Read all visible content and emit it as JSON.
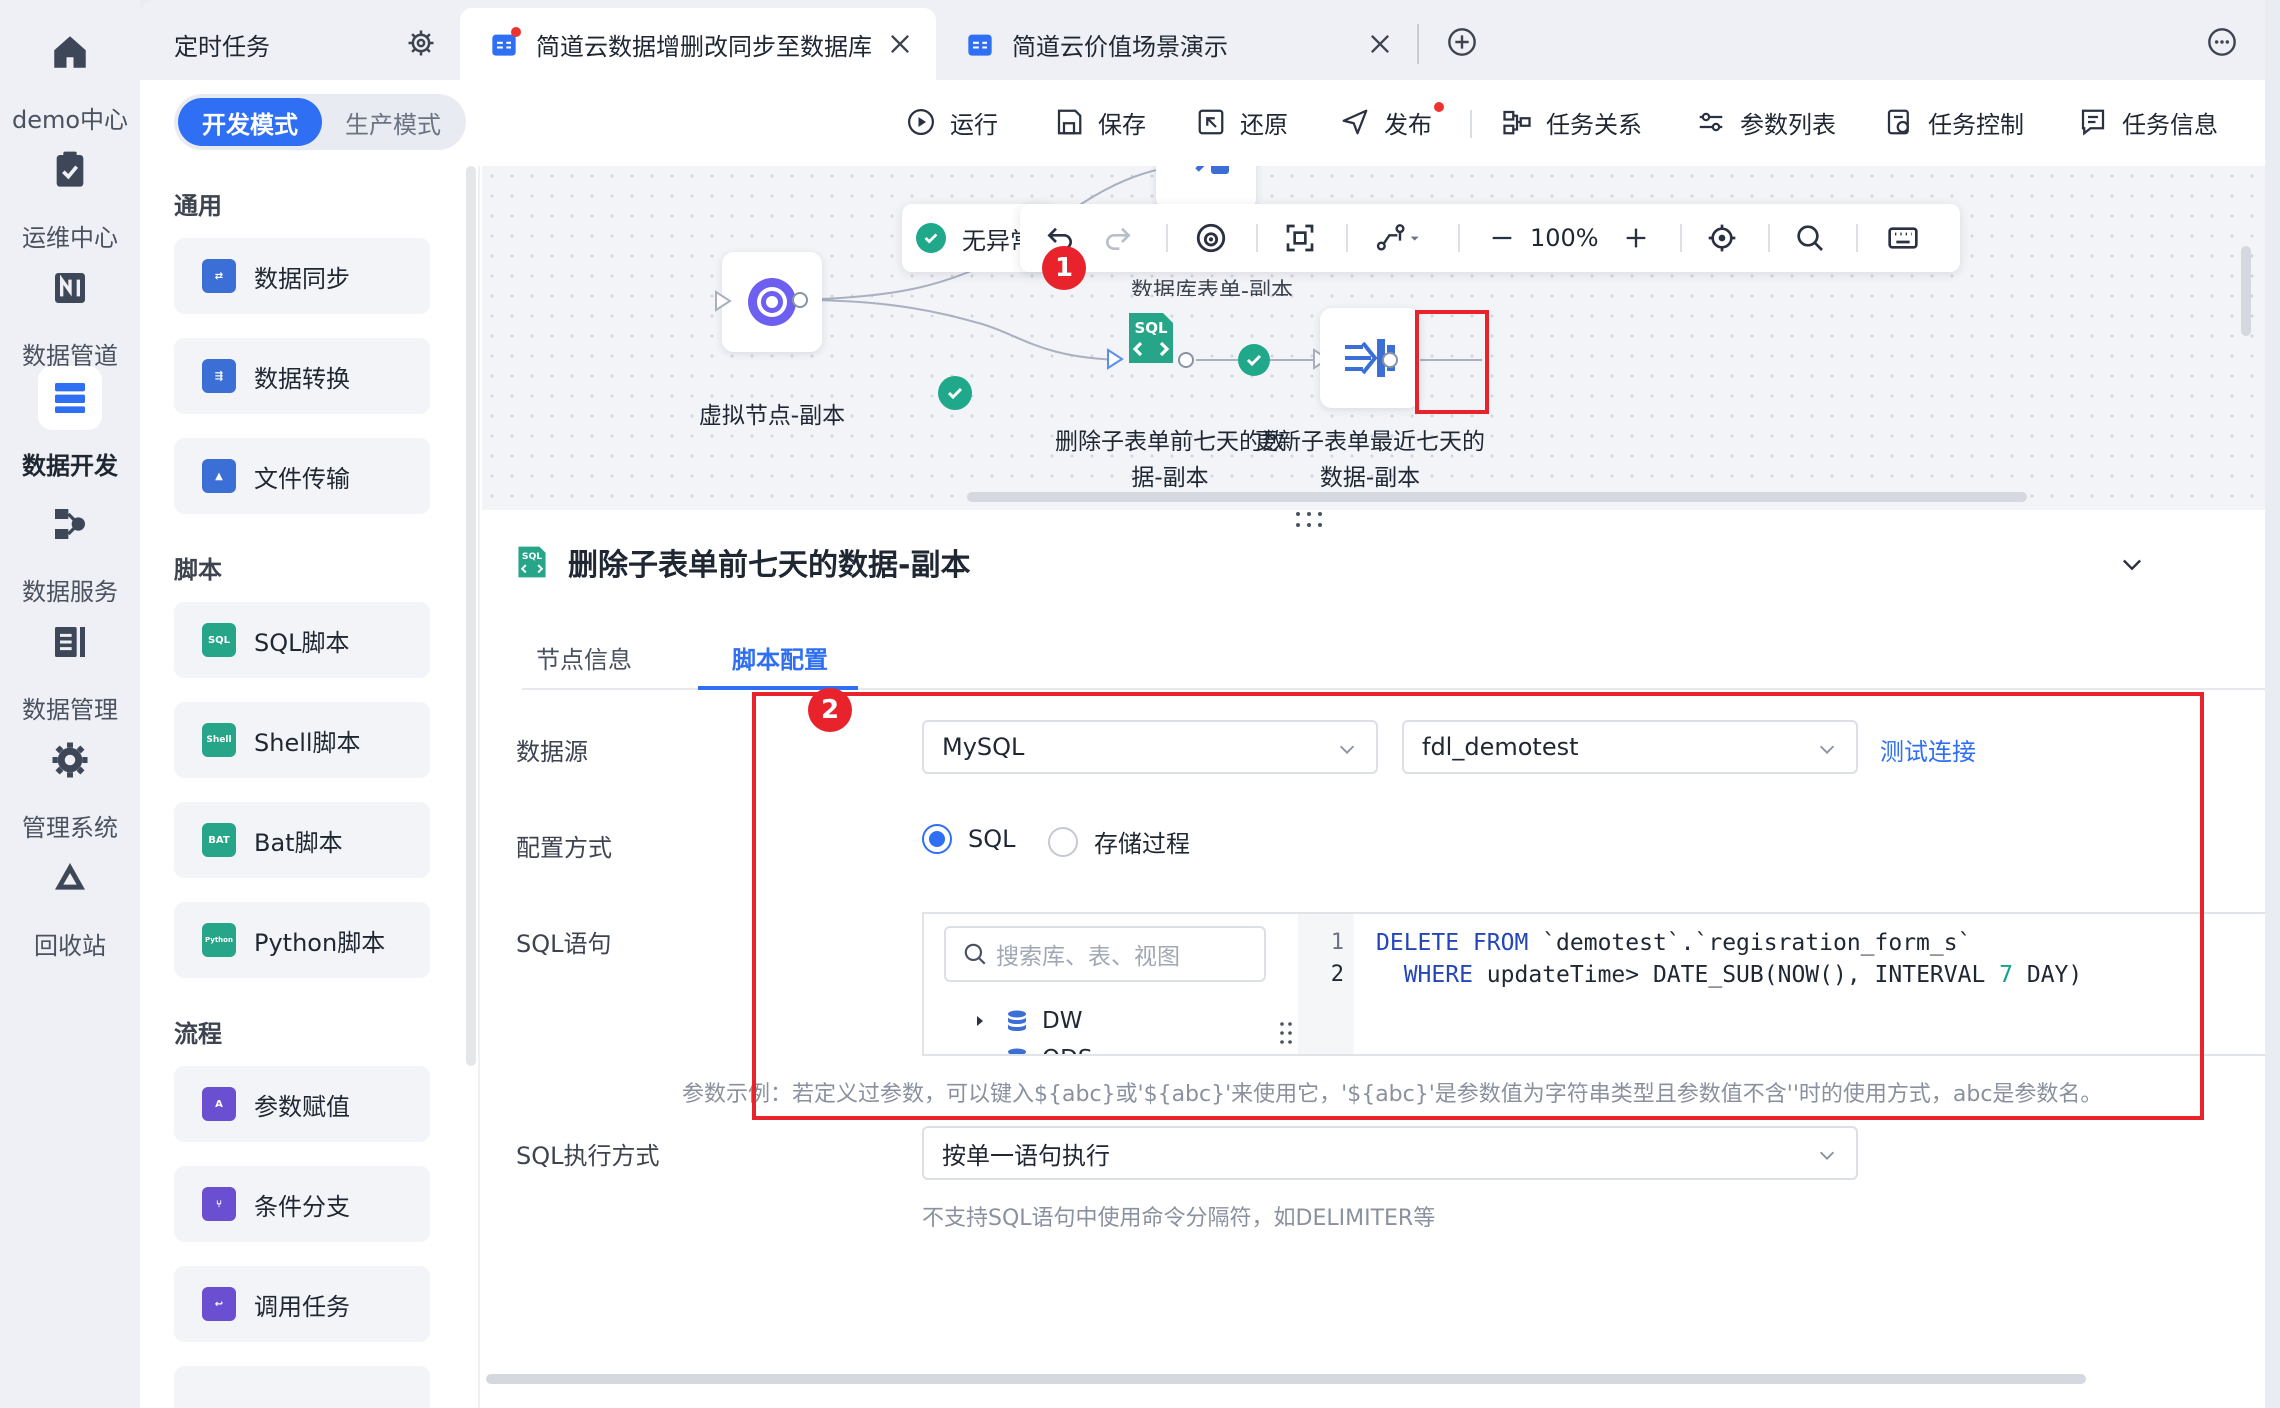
{
  "nav_rail": [
    {
      "label": "demo中心",
      "icon": "home-icon"
    },
    {
      "label": "运维中心",
      "icon": "clipboard-check-icon"
    },
    {
      "label": "数据管道",
      "icon": "pipeline-icon"
    },
    {
      "label": "数据开发",
      "icon": "data-dev-icon",
      "active": true
    },
    {
      "label": "数据服务",
      "icon": "data-service-icon"
    },
    {
      "label": "数据管理",
      "icon": "data-manage-icon"
    },
    {
      "label": "管理系统",
      "icon": "gear-icon"
    },
    {
      "label": "回收站",
      "icon": "recycle-icon"
    }
  ],
  "tabs": [
    {
      "label": "定时任务"
    },
    {
      "label": "简道云数据增删改同步至数据库",
      "active": true
    },
    {
      "label": "简道云价值场景演示"
    }
  ],
  "toolbar": {
    "mode_dev": "开发模式",
    "mode_prod": "生产模式",
    "run": "运行",
    "save": "保存",
    "restore": "还原",
    "publish": "发布",
    "task_relation": "任务关系",
    "param_list": "参数列表",
    "task_control": "任务控制",
    "task_info": "任务信息"
  },
  "components": {
    "general_title": "通用",
    "general": [
      "数据同步",
      "数据转换",
      "文件传输"
    ],
    "script_title": "脚本",
    "scripts": [
      "SQL脚本",
      "Shell脚本",
      "Bat脚本",
      "Python脚本"
    ],
    "flow_title": "流程",
    "flows": [
      "参数赋值",
      "条件分支",
      "调用任务"
    ]
  },
  "canvas": {
    "status": "无异常",
    "zoom": "100%",
    "partial_label": "数据库表单-副本",
    "nodes": {
      "virtual": "虚拟节点-副本",
      "sql_line1": "删除子表单前七天的数",
      "sql_line2": "据-副本",
      "update_line1": "更新子表单最近七天的",
      "update_line2": "数据-副本"
    },
    "sql_icon_text": "SQL",
    "badge1": "1",
    "badge2": "2"
  },
  "detail": {
    "title": "删除子表单前七天的数据-副本",
    "tab_node_info": "节点信息",
    "tab_script_config": "脚本配置",
    "label_datasource": "数据源",
    "datasource_type": "MySQL",
    "datasource_db": "fdl_demotest",
    "test_connection": "测试连接",
    "label_config_mode": "配置方式",
    "radio_sql": "SQL",
    "radio_procedure": "存储过程",
    "label_sql": "SQL语句",
    "search_placeholder": "搜索库、表、视图",
    "tree": [
      "DW",
      "ODS"
    ],
    "line_numbers": [
      "1",
      "2"
    ],
    "param_hint": "参数示例：若定义过参数，可以键入${abc}或'${abc}'来使用它，'${abc}'是参数值为字符串类型且参数值不含''时的使用方式，abc是参数名。",
    "label_exec_mode": "SQL执行方式",
    "exec_mode": "按单一语句执行",
    "exec_hint": "不支持SQL语句中使用命令分隔符，如DELIMITER等"
  },
  "colors": {
    "accent": "#2f6ff4",
    "success": "#1fa88a",
    "highlight": "#e8232c"
  }
}
